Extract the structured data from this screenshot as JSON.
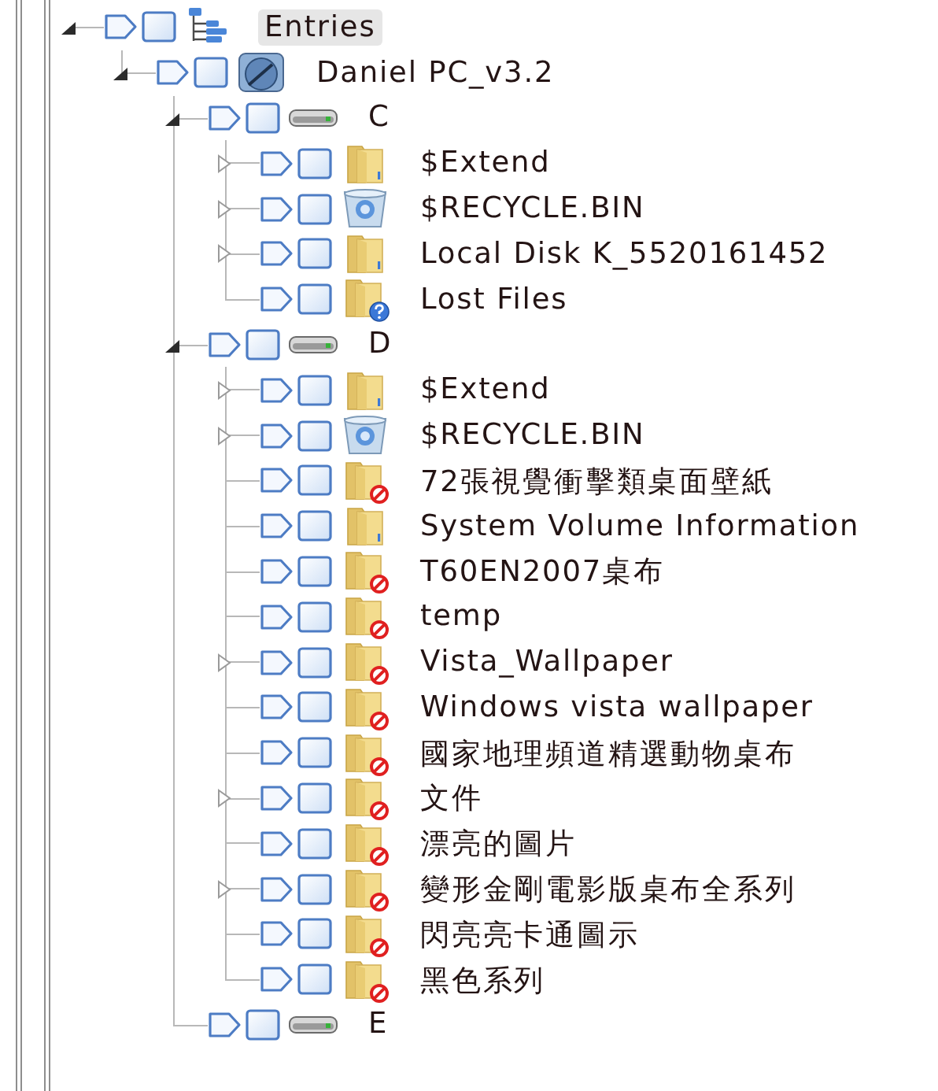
{
  "tree": [
    {
      "label": "Entries",
      "kind": "root",
      "expanded": true,
      "selected": true,
      "checked": false,
      "children": [
        {
          "label": "Daniel PC_v3.2",
          "kind": "computer",
          "expanded": true,
          "selected": false,
          "checked": false,
          "children": [
            {
              "label": "C",
              "kind": "drive",
              "expanded": true,
              "selected": false,
              "checked": false,
              "children": [
                {
                  "label": "$Extend",
                  "kind": "folder",
                  "expanded": false,
                  "selected": false,
                  "checked": false
                },
                {
                  "label": "$RECYCLE.BIN",
                  "kind": "recycle-bin",
                  "expanded": false,
                  "selected": false,
                  "checked": false
                },
                {
                  "label": "Local Disk K_5520161452",
                  "kind": "folder",
                  "expanded": false,
                  "selected": false,
                  "checked": false
                },
                {
                  "label": "Lost Files",
                  "kind": "lost-files",
                  "selected": false,
                  "checked": false
                }
              ]
            },
            {
              "label": "D",
              "kind": "drive",
              "expanded": true,
              "selected": false,
              "checked": false,
              "children": [
                {
                  "label": "$Extend",
                  "kind": "folder",
                  "expanded": false,
                  "selected": false,
                  "checked": false
                },
                {
                  "label": "$RECYCLE.BIN",
                  "kind": "recycle-bin",
                  "expanded": false,
                  "selected": false,
                  "checked": false
                },
                {
                  "label": "72張視覺衝擊類桌面壁紙",
                  "kind": "restricted-folder",
                  "selected": false,
                  "checked": false
                },
                {
                  "label": "System Volume Information",
                  "kind": "folder",
                  "selected": false,
                  "checked": false
                },
                {
                  "label": "T60EN2007桌布",
                  "kind": "restricted-folder",
                  "selected": false,
                  "checked": false
                },
                {
                  "label": "temp",
                  "kind": "restricted-folder",
                  "selected": false,
                  "checked": false
                },
                {
                  "label": "Vista_Wallpaper",
                  "kind": "restricted-folder",
                  "expanded": false,
                  "selected": false,
                  "checked": false
                },
                {
                  "label": "Windows vista wallpaper",
                  "kind": "restricted-folder",
                  "selected": false,
                  "checked": false
                },
                {
                  "label": "國家地理頻道精選動物桌布",
                  "kind": "restricted-folder",
                  "selected": false,
                  "checked": false
                },
                {
                  "label": "文件",
                  "kind": "restricted-folder",
                  "expanded": false,
                  "selected": false,
                  "checked": false
                },
                {
                  "label": "漂亮的圖片",
                  "kind": "restricted-folder",
                  "selected": false,
                  "checked": false
                },
                {
                  "label": "變形金剛電影版桌布全系列",
                  "kind": "restricted-folder",
                  "expanded": false,
                  "selected": false,
                  "checked": false
                },
                {
                  "label": "閃亮亮卡通圖示",
                  "kind": "restricted-folder",
                  "selected": false,
                  "checked": false
                },
                {
                  "label": "黑色系列",
                  "kind": "restricted-folder",
                  "selected": false,
                  "checked": false
                }
              ]
            },
            {
              "label": "E",
              "kind": "drive",
              "selected": false,
              "checked": false
            }
          ]
        }
      ]
    }
  ]
}
